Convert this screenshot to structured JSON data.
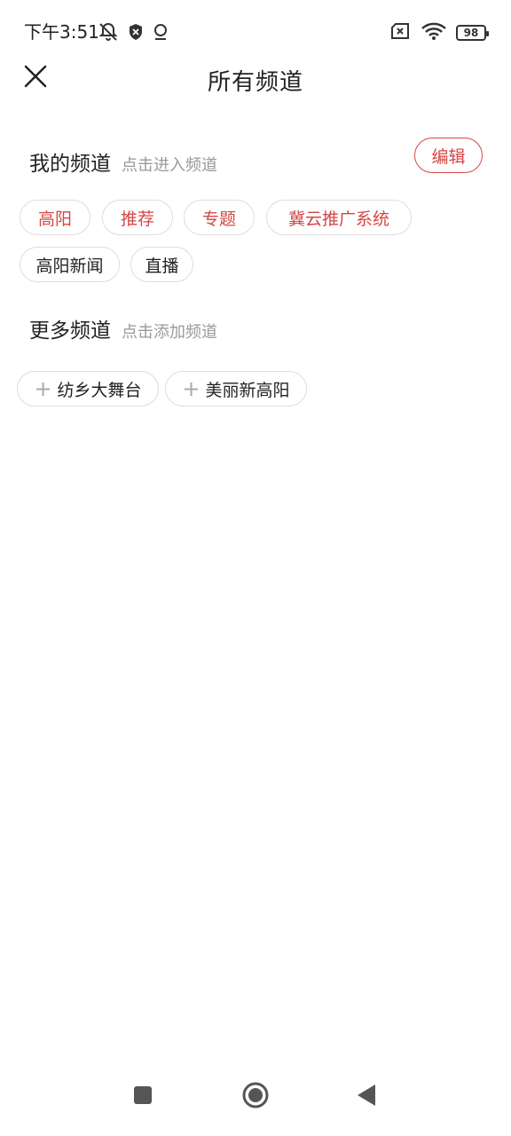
{
  "status": {
    "time": "下午3:51",
    "battery": "98"
  },
  "header": {
    "title": "所有频道"
  },
  "my_channels": {
    "title": "我的频道",
    "hint": "点击进入频道",
    "edit_label": "编辑",
    "items": [
      "高阳",
      "推荐",
      "专题",
      "冀云推广系统",
      "高阳新闻",
      "直播"
    ]
  },
  "more_channels": {
    "title": "更多频道",
    "hint": "点击添加频道",
    "items": [
      "纺乡大舞台",
      "美丽新高阳"
    ]
  },
  "icons": {
    "close": "close-icon",
    "mute": "bell-off-icon",
    "shield": "shield-icon",
    "location": "location-icon",
    "sim": "sim-off-icon",
    "wifi": "wifi-icon",
    "battery": "battery-icon",
    "nav_recent": "square-icon",
    "nav_home": "circle-icon",
    "nav_back": "triangle-back-icon"
  },
  "colors": {
    "accent": "#d64545",
    "text": "#222222",
    "hint": "#999999",
    "border": "#dddddd"
  }
}
